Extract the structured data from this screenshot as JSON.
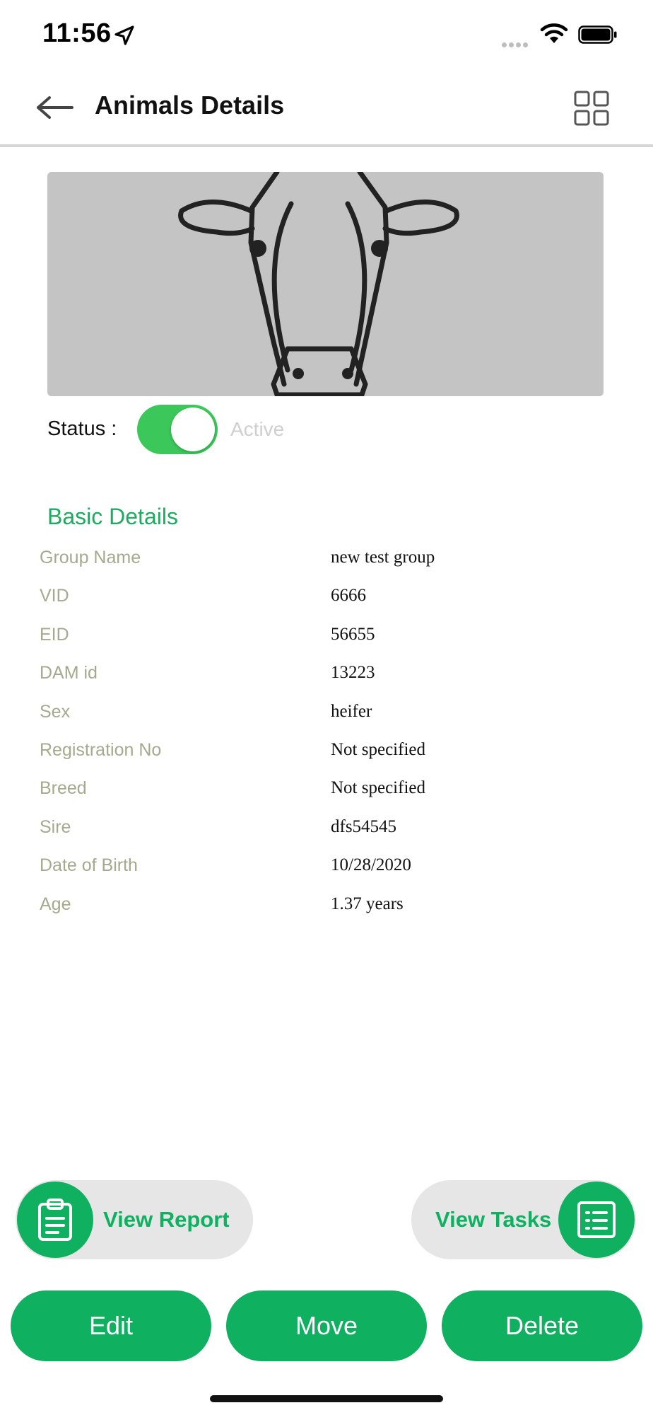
{
  "status_bar": {
    "time": "11:56",
    "icons": [
      "location-arrow-icon",
      "cellular-dots-icon",
      "wifi-icon",
      "battery-icon"
    ]
  },
  "header": {
    "title": "Animals Details",
    "back_icon": "arrow-left-icon",
    "menu_icon": "grid-icon"
  },
  "animal": {
    "image_icon": "cow-face-illustration",
    "status_label": "Status :",
    "status_value": "Active",
    "status_on": true
  },
  "basic_details": {
    "title": "Basic Details",
    "rows": [
      {
        "label": "Group Name",
        "value": "new test group"
      },
      {
        "label": "VID",
        "value": "6666"
      },
      {
        "label": "EID",
        "value": "56655"
      },
      {
        "label": "DAM id",
        "value": "13223"
      },
      {
        "label": "Sex",
        "value": "heifer"
      },
      {
        "label": "Registration No",
        "value": "Not specified"
      },
      {
        "label": "Breed",
        "value": "Not specified"
      },
      {
        "label": "Sire",
        "value": "dfs54545"
      },
      {
        "label": "Date of Birth",
        "value": "10/28/2020"
      },
      {
        "label": "Age",
        "value": "1.37 years"
      }
    ]
  },
  "actions": {
    "view_report": "View Report",
    "view_tasks": "View Tasks",
    "edit": "Edit",
    "move": "Move",
    "delete": "Delete"
  },
  "colors": {
    "accent": "#0fb060",
    "toggle_on": "#3cc75a",
    "label": "#a5a98e",
    "image_bg": "#c4c4c4",
    "pill_bg": "#e6e6e6"
  }
}
